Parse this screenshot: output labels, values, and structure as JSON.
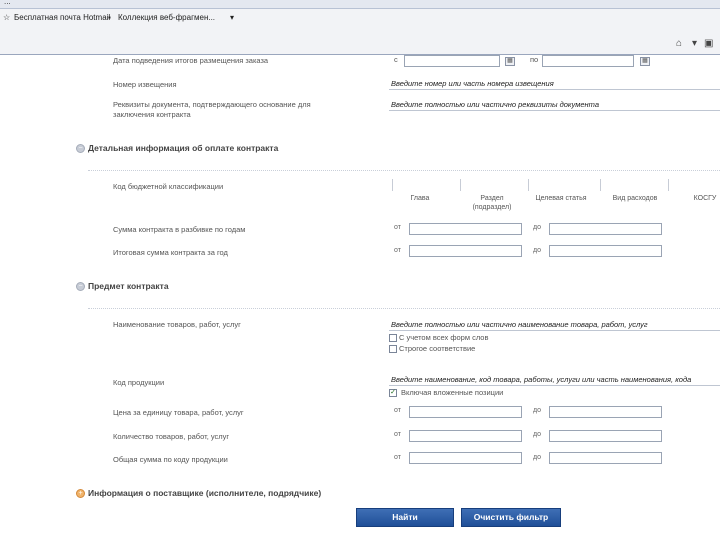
{
  "browser": {
    "tab_strip_text": "...",
    "favorites": [
      "Бесплатная почта Hotmail",
      "Коллекция веб-фрагмен..."
    ]
  },
  "form": {
    "order_date_label": "Дата подведения итогов размещения заказа",
    "date_from_prefix": "с",
    "date_to_prefix": "по",
    "notice_number_label": "Номер извещения",
    "notice_number_placeholder": "Введите номер или часть номера извещения",
    "requisites_label": "Реквизиты документа, подтверждающего основание для заключения контракта",
    "requisites_placeholder": "Введите полностью или частично реквизиты документа"
  },
  "sections": {
    "payment": "Детальная информация об оплате контракта",
    "subject": "Предмет контракта",
    "supplier": "Информация о поставщике (исполнителе, подрядчике)"
  },
  "payment": {
    "kbk_label": "Код бюджетной классификации",
    "kbk_columns": [
      "Глава",
      "Раздел (подраздел)",
      "Целевая статья",
      "Вид расходов",
      "КОСГУ"
    ],
    "sum_breakdown_label": "Сумма контракта в разбивке по годам",
    "total_year_label": "Итоговая сумма контракта за год",
    "from_label": "от",
    "to_label": "до"
  },
  "subject": {
    "goods_label": "Наименование товаров, работ, услуг",
    "goods_placeholder": "Введите полностью или частично наименование товара, работ, услуг",
    "option_all_forms": "С учетом всех форм слов",
    "option_strict": "Строгое соответствие",
    "product_code_label": "Код продукции",
    "product_code_placeholder": "Введите наименование, код товара, работы, услуги или часть наименования, кода",
    "include_nested": "Включая вложенные позиции",
    "include_nested_checked": true,
    "unit_price_label": "Цена за единицу товара, работ, услуг",
    "quantity_label": "Количество товаров, работ, услуг",
    "total_by_code_label": "Общая сумма по коду продукции",
    "from_label": "от",
    "to_label": "до"
  },
  "buttons": {
    "find": "Найти",
    "clear": "Очистить фильтр"
  },
  "colors": {
    "button_blue": "#2a5aa3",
    "section_icon_gray": "#c7ccd6",
    "section_icon_orange": "#f0b36a"
  }
}
